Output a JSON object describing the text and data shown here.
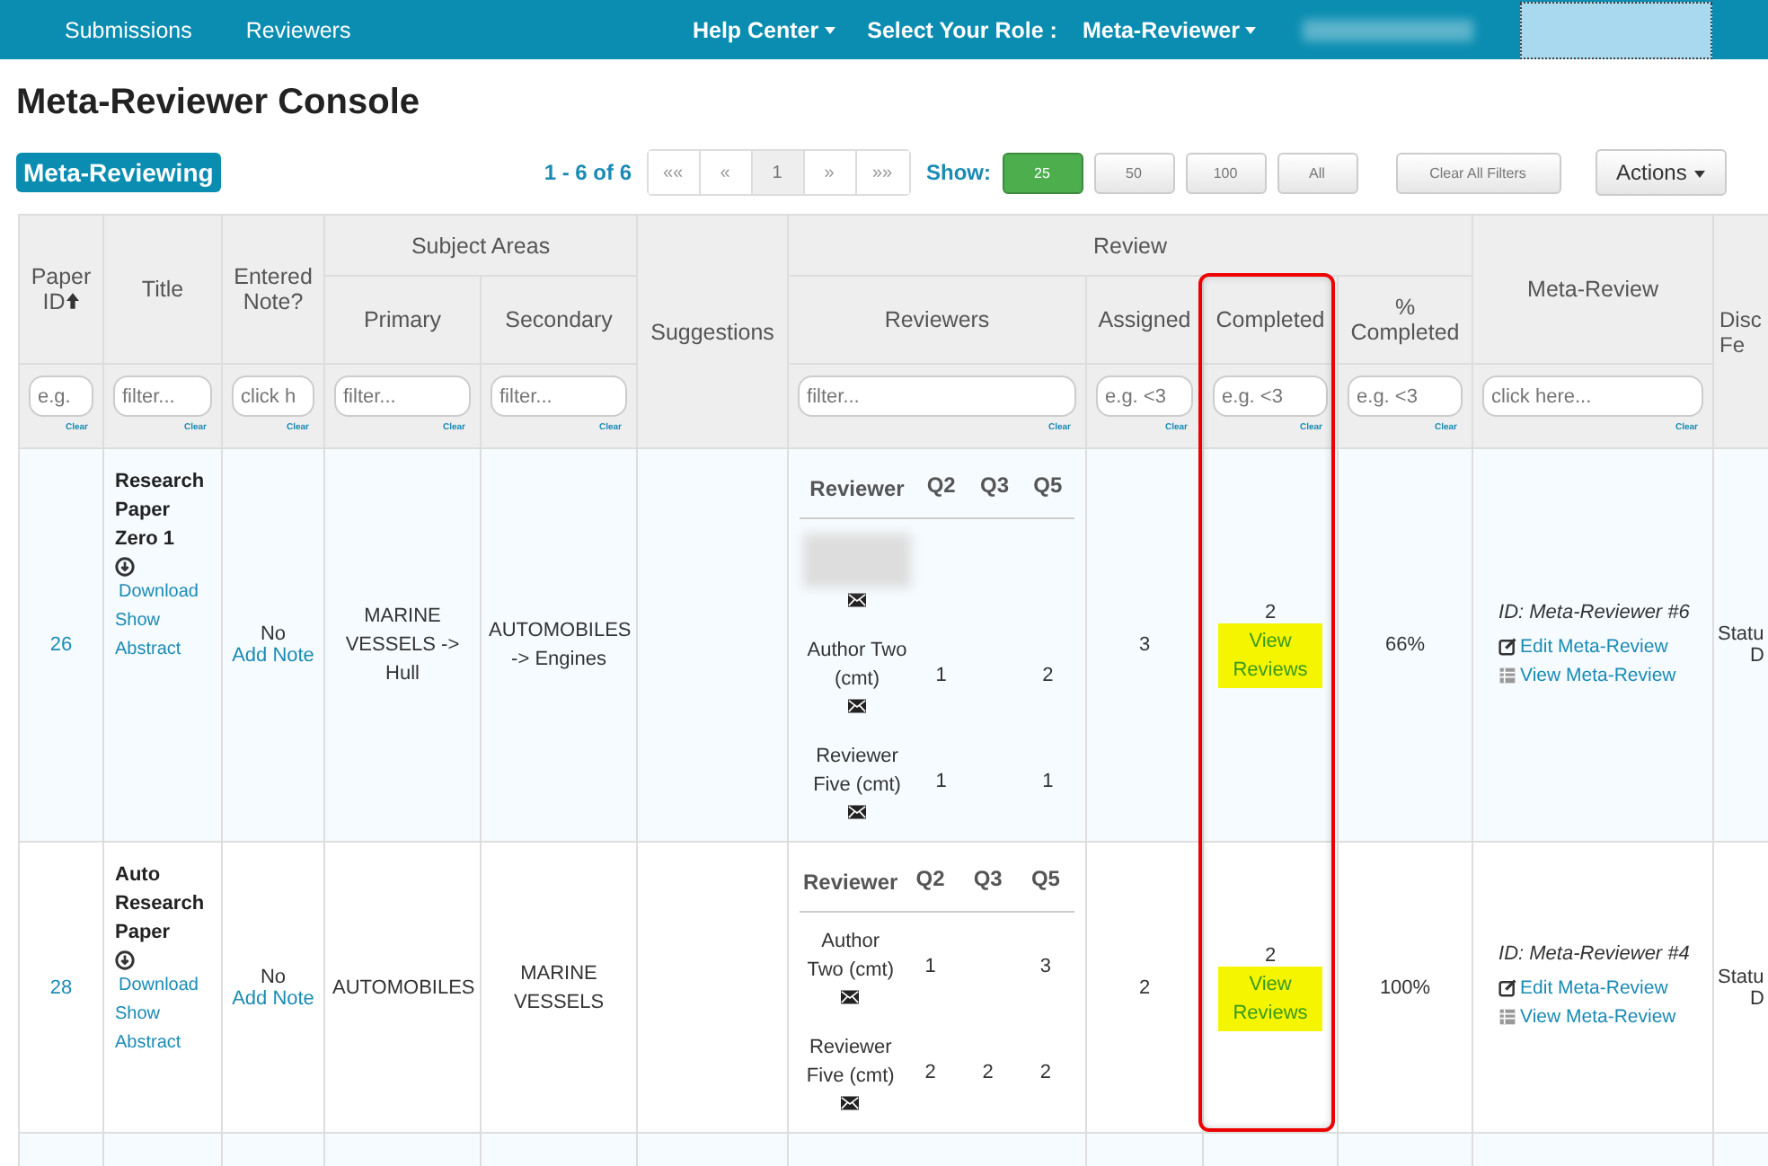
{
  "nav": {
    "left": [
      "Submissions",
      "Reviewers"
    ],
    "help": "Help Center",
    "role_label": "Select Your Role :",
    "role": "Meta-Reviewer"
  },
  "page_title": "Meta-Reviewer Console",
  "section_badge": "Meta-Reviewing",
  "pager": {
    "summary": "1 - 6 of 6",
    "buttons": [
      {
        "label": "««",
        "selected": false
      },
      {
        "label": "«",
        "selected": false
      },
      {
        "label": "1",
        "selected": true
      },
      {
        "label": "»",
        "selected": false
      },
      {
        "label": "»»",
        "selected": false
      }
    ]
  },
  "show": {
    "label": "Show:",
    "options": [
      {
        "label": "25",
        "selected": true
      },
      {
        "label": "50",
        "selected": false
      },
      {
        "label": "100",
        "selected": false
      },
      {
        "label": "All",
        "selected": false
      }
    ]
  },
  "clear_all": "Clear All Filters",
  "actions": "Actions",
  "table": {
    "columns": [
      {
        "kind": "single",
        "label": "Paper ID",
        "sorted": true,
        "placeholder": "e.g.",
        "clear": "Clear"
      },
      {
        "kind": "single",
        "label": "Title",
        "sorted": false,
        "placeholder": "filter...",
        "clear": "Clear"
      },
      {
        "kind": "single",
        "label": "Entered Note?",
        "sorted": false,
        "placeholder": "click h",
        "clear": "Clear"
      },
      {
        "kind": "group",
        "label": "Subject Areas",
        "columns": [
          {
            "label": "Primary",
            "placeholder": "filter...",
            "clear": "Clear"
          },
          {
            "label": "Secondary",
            "placeholder": "filter...",
            "clear": "Clear"
          }
        ]
      },
      {
        "kind": "single",
        "label": "Suggestions",
        "sorted": false
      },
      {
        "kind": "group",
        "label": "Review",
        "columns": [
          {
            "label": "Reviewers",
            "placeholder": "filter...",
            "clear": "Clear"
          },
          {
            "label": "Assigned",
            "placeholder": "e.g. <3",
            "clear": "Clear"
          },
          {
            "label": "Completed",
            "placeholder": "e.g. <3",
            "clear": "Clear"
          },
          {
            "label": "% Completed",
            "placeholder": "e.g. <3",
            "clear": "Clear"
          }
        ]
      },
      {
        "kind": "single",
        "label": "Meta-Review",
        "sorted": false,
        "placeholder": "click here...",
        "clear": "Clear"
      },
      {
        "kind": "single",
        "label": "Disc\nFe"
      }
    ],
    "rows": [
      {
        "id": "26",
        "title": "Research Paper Zero 1",
        "download": "Download",
        "abstract": "Show Abstract",
        "note": "No",
        "add_note": "Add Note",
        "primary": "MARINE VESSELS -> Hull",
        "secondary": "AUTOMOBILES -> Engines",
        "reviewer_head": [
          "Reviewer",
          "Q2",
          "Q3",
          "Q5"
        ],
        "reviewers": [
          {
            "kind": "blurred"
          },
          {
            "kind": "named",
            "name": "Author Two (cmt)",
            "q2": "1",
            "q5": "2"
          },
          {
            "kind": "named",
            "name": "Reviewer Five (cmt)",
            "q2": "1",
            "q5": "1"
          }
        ],
        "assigned": "3",
        "completed": "2",
        "view_reviews": "View Reviews",
        "percent": "66%",
        "meta_id": "ID: Meta-Reviewer #6",
        "edit": "Edit Meta-Review",
        "view": "View Meta-Review",
        "disc": [
          "Statu",
          "D"
        ]
      },
      {
        "id": "28",
        "title": "Auto Research Paper",
        "download": "Download",
        "abstract": "Show Abstract",
        "note": "No",
        "add_note": "Add Note",
        "primary": "AUTOMOBILES",
        "secondary": "MARINE VESSELS",
        "reviewer_head": [
          "Reviewer",
          "Q2",
          "Q3",
          "Q5"
        ],
        "reviewers": [
          {
            "kind": "named",
            "name": "Author Two (cmt)",
            "q2": "1",
            "q5": "3"
          },
          {
            "kind": "named",
            "name": "Reviewer Five (cmt)",
            "q2": "2",
            "q3": "2",
            "q5": "2"
          }
        ],
        "assigned": "2",
        "completed": "2",
        "view_reviews": "View Reviews",
        "percent": "100%",
        "meta_id": "ID: Meta-Reviewer #4",
        "edit": "Edit Meta-Review",
        "view": "View Meta-Review",
        "disc": [
          "Statu",
          "D"
        ]
      }
    ]
  }
}
